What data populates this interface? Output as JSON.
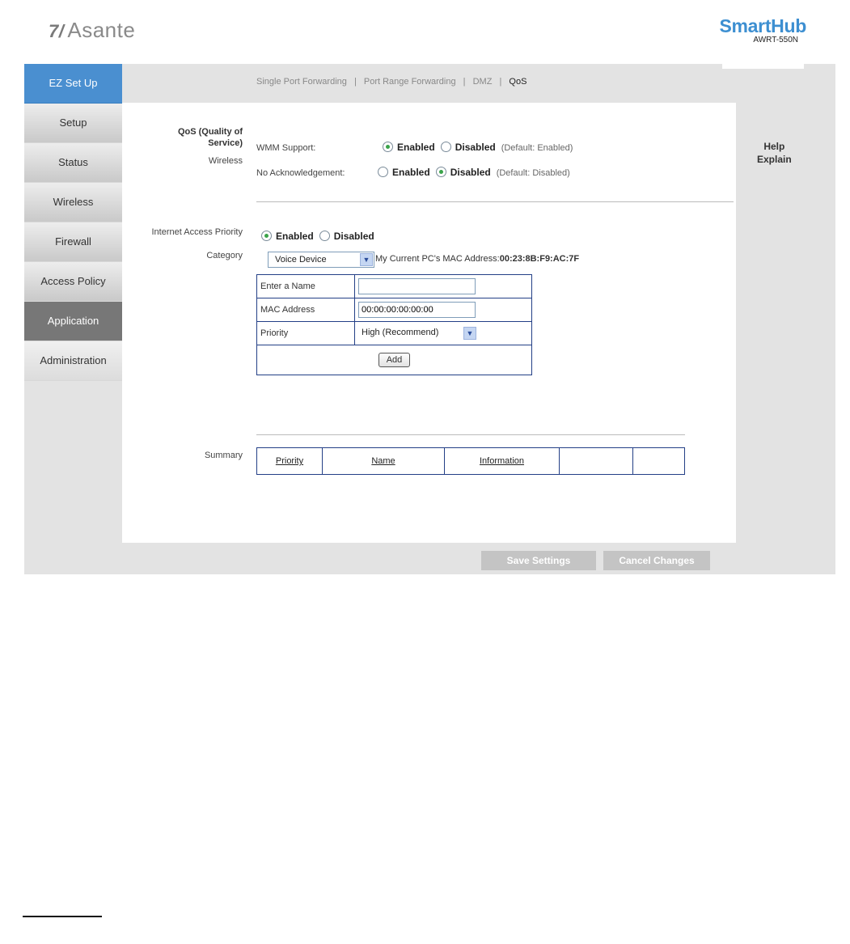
{
  "header": {
    "brand_mark": "7/",
    "brand": "Asante",
    "product_name": "SmartHub",
    "product_model": "AWRT-550N"
  },
  "sidebar": {
    "items": [
      {
        "label": "EZ Set Up"
      },
      {
        "label": "Setup"
      },
      {
        "label": "Status"
      },
      {
        "label": "Wireless"
      },
      {
        "label": "Firewall"
      },
      {
        "label": "Access Policy"
      },
      {
        "label": "Application"
      },
      {
        "label": "Administration"
      }
    ]
  },
  "subnav": {
    "tabs": [
      "Single Port Forwarding",
      "Port Range Forwarding",
      "DMZ",
      "QoS"
    ],
    "separator": "|"
  },
  "qos": {
    "section_label_1": "QoS (Quality of",
    "section_label_2": "Service)",
    "wireless_label": "Wireless",
    "wmm_label": "WMM Support:",
    "wmm_enabled": "Enabled",
    "wmm_disabled": "Disabled",
    "wmm_default": "(Default: Enabled)",
    "noack_label": "No Acknowledgement:",
    "noack_enabled": "Enabled",
    "noack_disabled": "Disabled",
    "noack_default": "(Default: Disabled)"
  },
  "internet_priority": {
    "label": "Internet Access Priority",
    "enabled": "Enabled",
    "disabled": "Disabled",
    "category_label": "Category",
    "category_value": "Voice Device",
    "mac_prefix": "My Current PC's MAC Address:",
    "mac_value": "00:23:8B:F9:AC:7F",
    "name_label": "Enter a Name",
    "name_value": "",
    "mac_label": "MAC Address",
    "mac_input": "00:00:00:00:00:00",
    "priority_label": "Priority",
    "priority_value": "High (Recommend)",
    "add_label": "Add"
  },
  "summary": {
    "label": "Summary",
    "columns": [
      "Priority",
      "Name",
      "Information",
      "",
      ""
    ]
  },
  "buttons": {
    "save": "Save Settings",
    "cancel": "Cancel Changes"
  },
  "help": {
    "line1": "Help",
    "line2": "Explain"
  }
}
